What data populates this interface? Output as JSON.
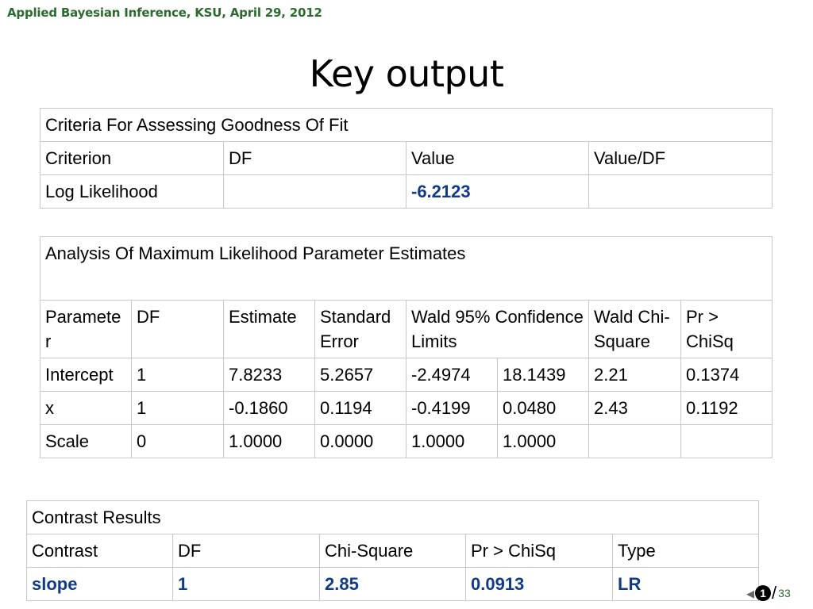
{
  "header": {
    "text": "Applied Bayesian Inference, KSU, April 29, 2012"
  },
  "slide": {
    "title": "Key output"
  },
  "goodness_of_fit": {
    "caption": "Criteria For Assessing Goodness Of Fit",
    "columns": [
      "Criterion",
      "DF",
      "Value",
      "Value/DF"
    ],
    "rows": [
      {
        "criterion": "Log Likelihood",
        "df": "",
        "value": "-6.2123",
        "value_df": ""
      }
    ]
  },
  "parameter_estimates": {
    "caption": "Analysis Of Maximum Likelihood Parameter Estimates",
    "columns": {
      "parameter": "Parameter",
      "df": "DF",
      "estimate": "Estimate",
      "std_error": "Standard Error",
      "wald_limits": "Wald 95% Confidence Limits",
      "wald_chisq": "Wald Chi-Square",
      "pr_chisq": "Pr > ChiSq"
    },
    "rows": [
      {
        "parameter": "Intercept",
        "df": "1",
        "estimate": "7.8233",
        "std_error": "5.2657",
        "lower": "-2.4974",
        "upper": "18.1439",
        "wald_chisq": "2.21",
        "pr_chisq": "0.1374"
      },
      {
        "parameter": "x",
        "df": "1",
        "estimate": "-0.1860",
        "std_error": "0.1194",
        "lower": "-0.4199",
        "upper": "0.0480",
        "wald_chisq": "2.43",
        "pr_chisq": "0.1192"
      },
      {
        "parameter": "Scale",
        "df": "0",
        "estimate": "1.0000",
        "std_error": "0.0000",
        "lower": "1.0000",
        "upper": "1.0000",
        "wald_chisq": "",
        "pr_chisq": ""
      }
    ]
  },
  "contrast_results": {
    "caption": "Contrast Results",
    "columns": [
      "Contrast",
      "DF",
      "Chi-Square",
      "Pr > ChiSq",
      "Type"
    ],
    "rows": [
      {
        "contrast": "slope",
        "df": "1",
        "chisq": "2.85",
        "pr_chisq": "0.0913",
        "type": "LR"
      }
    ]
  },
  "pager": {
    "prev_glyph": "◂",
    "current": "1",
    "separator": "/",
    "total": "33"
  },
  "colors": {
    "header_green": "#2b6b2e",
    "value_blue": "#103a8a",
    "grid_gray": "#c8c8c8"
  }
}
